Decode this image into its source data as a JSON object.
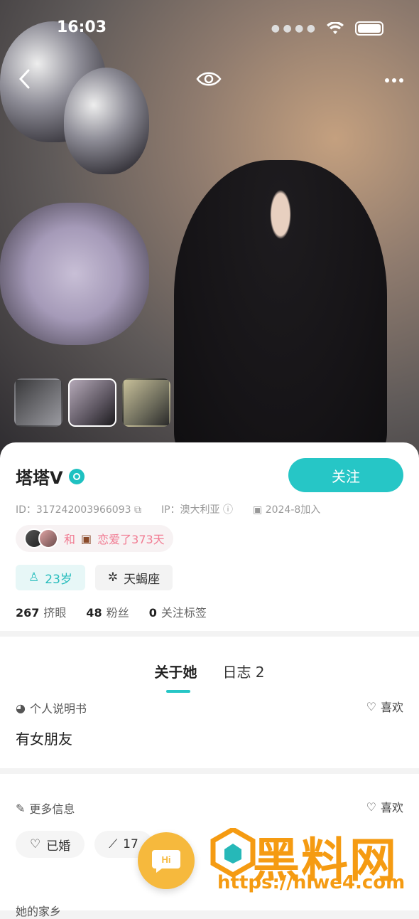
{
  "status_bar": {
    "time": "16:03"
  },
  "profile": {
    "name": "塔塔V",
    "follow_label": "关注",
    "id_text": "ID：317242003966093",
    "ip_text": "IP：澳大利亚",
    "joined_text": "2024-8加入",
    "love_prefix": "和",
    "love_text": "恋爱了373天",
    "age_tag": "23岁",
    "zodiac_tag": "天蝎座",
    "stats": [
      {
        "num": "267",
        "label": "挤眼"
      },
      {
        "num": "48",
        "label": "粉丝"
      },
      {
        "num": "0",
        "label": "关注标签"
      }
    ]
  },
  "tabs": [
    {
      "label": "关于她"
    },
    {
      "label": "日志 2"
    }
  ],
  "bio_section": {
    "title": "个人说明书",
    "like_label": "喜欢",
    "content": "有女朋友"
  },
  "more_section": {
    "title": "更多信息",
    "like_label": "喜欢",
    "chips": [
      {
        "label": "已婚"
      },
      {
        "label": "17"
      }
    ]
  },
  "next_section": {
    "title": "她的家乡"
  },
  "fab": {
    "label": "Hi"
  },
  "watermark": {
    "title": "黑料网",
    "url": "https://hlwe4.com"
  },
  "colors": {
    "accent": "#26c6c6",
    "love": "#f17b92",
    "fab": "#f6b93d",
    "watermark": "#f59b12"
  }
}
